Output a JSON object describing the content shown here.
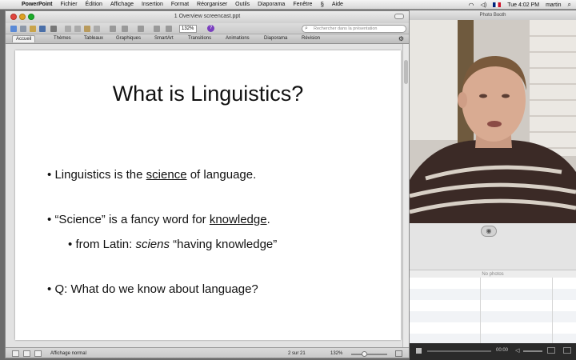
{
  "menubar": {
    "app_name": "PowerPoint",
    "items": [
      "Fichier",
      "Édition",
      "Affichage",
      "Insertion",
      "Format",
      "Réorganiser",
      "Outils",
      "Diaporama",
      "Fenêtre",
      "Aide"
    ],
    "clock": "Tue 4:02 PM",
    "user": "martin"
  },
  "ppt": {
    "title": "1 Overview screencast.ppt",
    "zoom_value": "132%",
    "search_placeholder": "Rechercher dans la présentation",
    "ribbon_tabs": [
      "Accueil",
      "Thèmes",
      "Tableaux",
      "Graphiques",
      "SmartArt",
      "Transitions",
      "Animations",
      "Diaporama",
      "Révision"
    ],
    "slide": {
      "title": "What is Linguistics?",
      "b1_pre": "Linguistics is the ",
      "b1_u": "science",
      "b1_post": " of language.",
      "b2_pre": "“Science” is a fancy word for ",
      "b2_u": "knowledge",
      "b2_post": ".",
      "b3_pre": "from Latin: ",
      "b3_i": "sciens",
      "b3_post": " “having knowledge”",
      "b4": "Q: What do we know about language?"
    },
    "status": {
      "view_label": "Affichage normal",
      "slide_counter": "2 sur 21",
      "zoom": "132%"
    }
  },
  "photobooth": {
    "title": "Photo Booth",
    "no_photos": "No photos",
    "time": "00:00"
  },
  "icons": {
    "bullet": "•",
    "camera": "◉",
    "search": "⌕",
    "help": "?"
  }
}
